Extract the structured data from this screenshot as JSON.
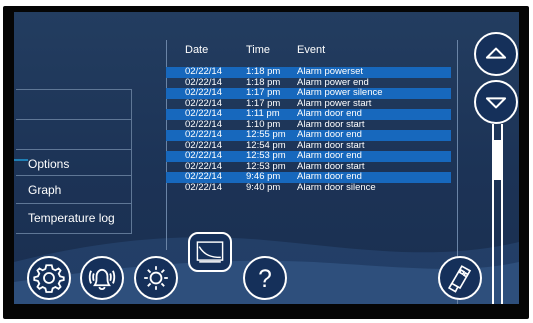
{
  "options_menu": {
    "items": [
      {
        "label": "Options"
      },
      {
        "label": "Graph"
      },
      {
        "label": "Temperature log"
      }
    ]
  },
  "event_log": {
    "columns": {
      "date": "Date",
      "time": "Time",
      "event": "Event"
    },
    "rows": [
      {
        "date": "02/22/14",
        "time": "1:18 pm",
        "event": "Alarm powerset",
        "highlighted": true
      },
      {
        "date": "02/22/14",
        "time": "1:18 pm",
        "event": "Alarm power end",
        "highlighted": false
      },
      {
        "date": "02/22/14",
        "time": "1:17 pm",
        "event": "Alarm power silence",
        "highlighted": true
      },
      {
        "date": "02/22/14",
        "time": "1:17 pm",
        "event": "Alarm power start",
        "highlighted": false
      },
      {
        "date": "02/22/14",
        "time": "1:11 pm",
        "event": "Alarm door end",
        "highlighted": true
      },
      {
        "date": "02/22/14",
        "time": "1:10 pm",
        "event": "Alarm door start",
        "highlighted": false
      },
      {
        "date": "02/22/14",
        "time": "12:55 pm",
        "event": "Alarm door end",
        "highlighted": true
      },
      {
        "date": "02/22/14",
        "time": "12:54 pm",
        "event": "Alarm door start",
        "highlighted": false
      },
      {
        "date": "02/22/14",
        "time": "12:53 pm",
        "event": "Alarm door end",
        "highlighted": true
      },
      {
        "date": "02/22/14",
        "time": "12:53 pm",
        "event": "Alarm door start",
        "highlighted": false
      },
      {
        "date": "02/22/14",
        "time": "9:46 pm",
        "event": "Alarm door end",
        "highlighted": true
      },
      {
        "date": "02/22/14",
        "time": "9:40 pm",
        "event": "Alarm door silence",
        "highlighted": false
      }
    ]
  },
  "toolbar": {
    "help_symbol": "?",
    "icons": [
      "gear-icon",
      "alarm-bell-icon",
      "brightness-icon",
      "graph-icon",
      "help-icon",
      "usb-icon",
      "scroll-up-icon",
      "scroll-down-icon"
    ]
  },
  "colors": {
    "background": "#1c3356",
    "row_highlight": "#1768bd",
    "frame": "#050505"
  }
}
